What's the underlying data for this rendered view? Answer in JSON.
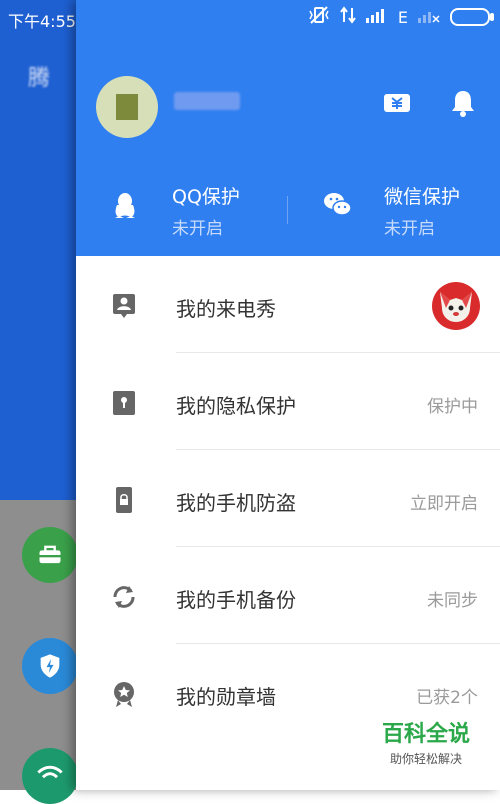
{
  "background_app": {
    "time": "下午4:55",
    "title": "腾"
  },
  "status_bar": {
    "network": "E"
  },
  "drawer_header": {
    "qq_protection": {
      "title": "QQ保护",
      "status": "未开启"
    },
    "wechat_protection": {
      "title": "微信保护",
      "status": "未开启"
    }
  },
  "menu": {
    "items": [
      {
        "label": "我的来电秀",
        "status": ""
      },
      {
        "label": "我的隐私保护",
        "status": "保护中"
      },
      {
        "label": "我的手机防盗",
        "status": "立即开启"
      },
      {
        "label": "我的手机备份",
        "status": "未同步"
      },
      {
        "label": "我的勋章墙",
        "status": "已获2个"
      }
    ]
  },
  "watermark": {
    "title": "百科全说",
    "subtitle": "助你轻松解决"
  },
  "colors": {
    "header_blue": "#2f7ff0",
    "background_blue": "#1e5fd2",
    "watermark_green": "#2ba84a"
  }
}
